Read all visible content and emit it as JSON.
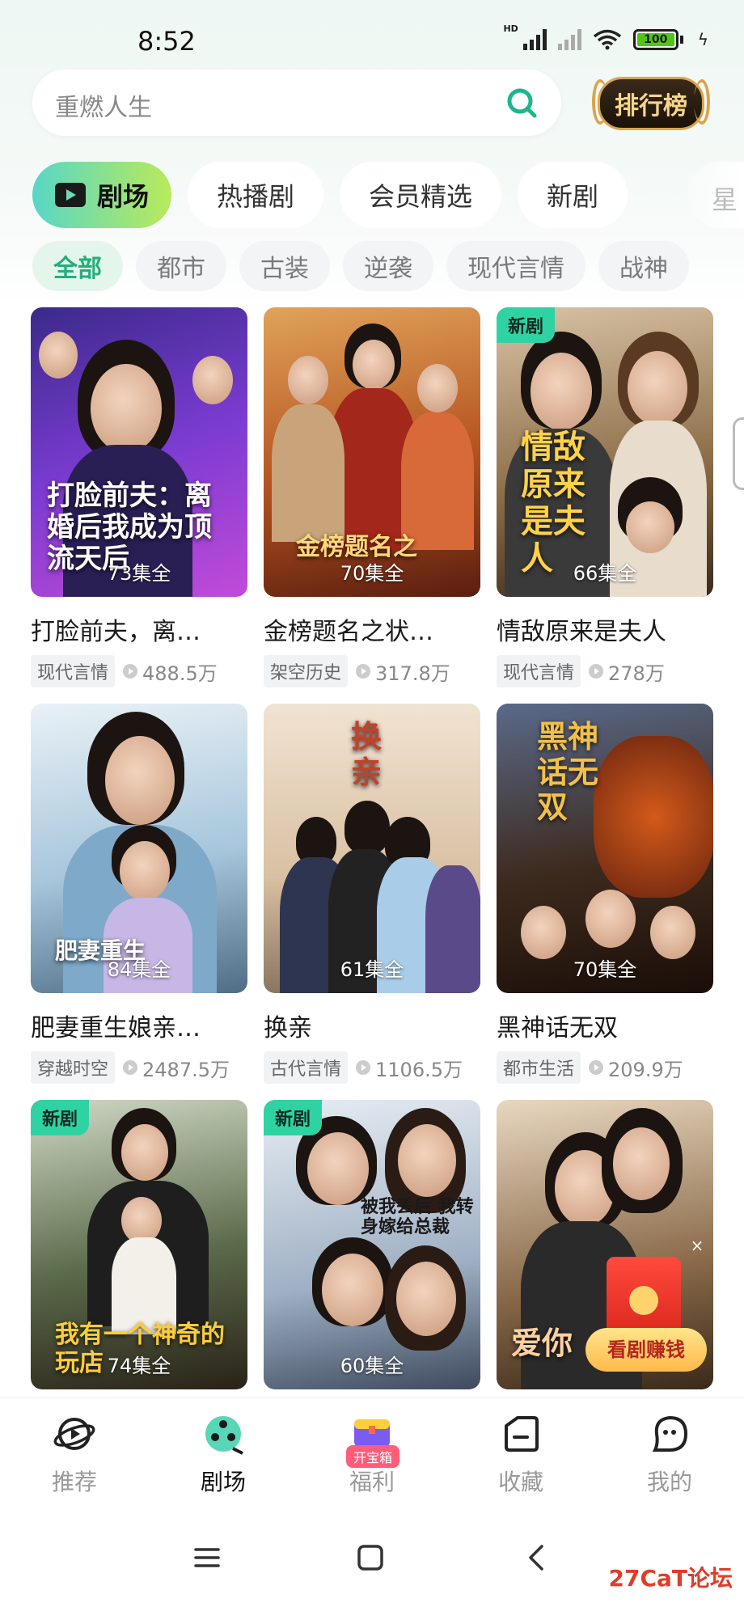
{
  "status_bar": {
    "time": "8:52",
    "network_badge": "HD",
    "battery": "100"
  },
  "search": {
    "placeholder": "重燃人生"
  },
  "rank_button": {
    "label": "排行榜"
  },
  "main_tabs": [
    {
      "label": "剧场",
      "active": true
    },
    {
      "label": "热播剧"
    },
    {
      "label": "会员精选"
    },
    {
      "label": "新剧"
    },
    {
      "label": "星"
    }
  ],
  "sub_categories": [
    {
      "label": "全部",
      "active": true
    },
    {
      "label": "都市"
    },
    {
      "label": "古装"
    },
    {
      "label": "逆袭"
    },
    {
      "label": "现代言情"
    },
    {
      "label": "战神"
    }
  ],
  "dramas": [
    {
      "title": "打脸前夫，离…",
      "tag": "现代言情",
      "plays": "488.5万",
      "episodes": "73集全",
      "poster_text": "打脸前夫：离婚后我成为顶流天后",
      "is_new": false,
      "accent": "#7a3bd1"
    },
    {
      "title": "金榜题名之状…",
      "tag": "架空历史",
      "plays": "317.8万",
      "episodes": "70集全",
      "poster_text": "金榜题名之",
      "is_new": false,
      "accent": "#b5521f"
    },
    {
      "title": "情敌原来是夫人",
      "tag": "现代言情",
      "plays": "278万",
      "episodes": "66集全",
      "poster_text": "情敌原来是夫人",
      "is_new": true,
      "new_label": "新剧",
      "accent": "#8a6a45"
    },
    {
      "title": "肥妻重生娘亲…",
      "tag": "穿越时空",
      "plays": "2487.5万",
      "episodes": "84集全",
      "poster_text": "肥妻重生",
      "is_new": false,
      "accent": "#7fa9c9"
    },
    {
      "title": "换亲",
      "tag": "古代言情",
      "plays": "1106.5万",
      "episodes": "61集全",
      "poster_text": "换亲",
      "is_new": false,
      "accent": "#c9a98a"
    },
    {
      "title": "黑神话无双",
      "tag": "都市生活",
      "plays": "209.9万",
      "episodes": "70集全",
      "poster_text": "黑神话无双",
      "is_new": false,
      "accent": "#3d2a1e"
    },
    {
      "title": "",
      "tag": "",
      "plays": "",
      "episodes": "74集全",
      "poster_text": "我有一个神奇的玩店",
      "is_new": true,
      "new_label": "新剧",
      "accent": "#5a6b4a"
    },
    {
      "title": "",
      "tag": "",
      "plays": "",
      "episodes": "60集全",
      "poster_text": "被我丢后 我转身嫁给总裁",
      "is_new": true,
      "new_label": "新剧",
      "accent": "#9fb0c4"
    },
    {
      "title": "",
      "tag": "",
      "plays": "",
      "episodes": "",
      "poster_text": "爱你",
      "is_new": false,
      "accent": "#8a6a4a"
    }
  ],
  "floating_promo": {
    "label": "看剧赚钱",
    "close": "×"
  },
  "bottom_nav": [
    {
      "label": "推荐",
      "icon": "planet-play-icon"
    },
    {
      "label": "剧场",
      "icon": "film-reel-icon",
      "active": true
    },
    {
      "label": "福利",
      "icon": "treasure-box-icon",
      "badge": "开宝箱"
    },
    {
      "label": "收藏",
      "icon": "folder-icon"
    },
    {
      "label": "我的",
      "icon": "profile-blob-icon"
    }
  ],
  "watermark": "27CaT论坛"
}
